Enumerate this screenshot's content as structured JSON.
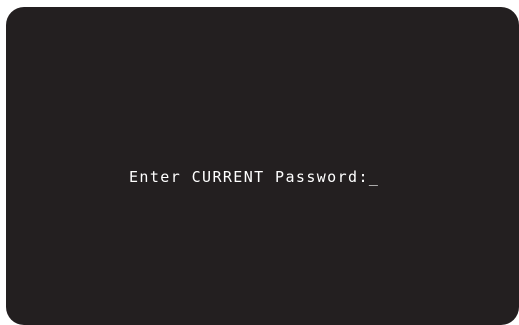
{
  "terminal": {
    "prompt": "Enter CURRENT Password:",
    "cursor": "_"
  },
  "colors": {
    "screen_background": "#231f20",
    "text": "#ffffff",
    "page_background": "#ffffff"
  }
}
